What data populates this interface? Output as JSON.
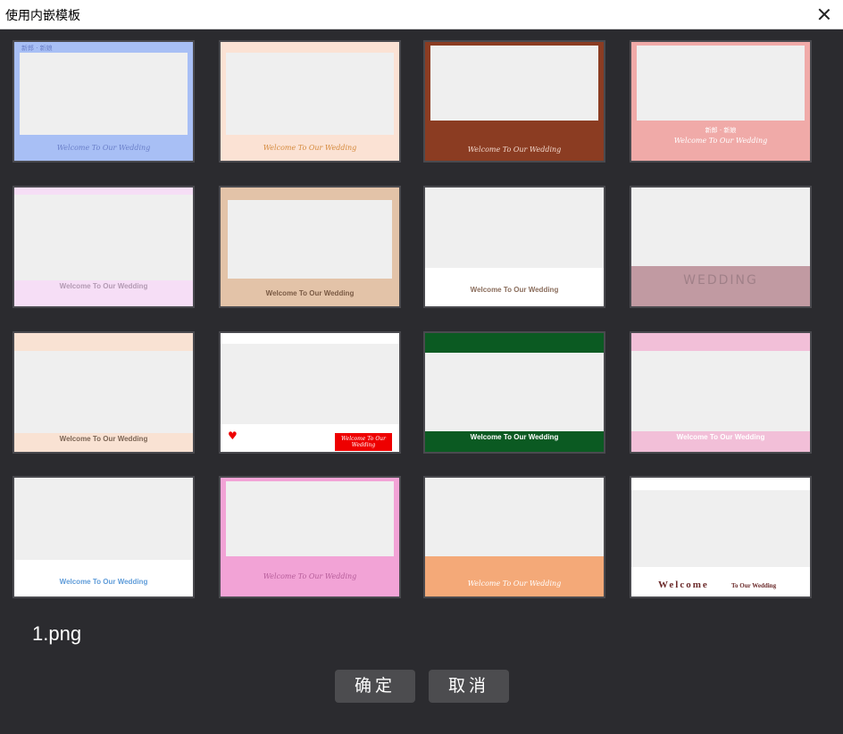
{
  "window": {
    "title": "使用内嵌模板"
  },
  "templates": [
    {
      "caption": "Welcome To Our Wedding",
      "header_text": "新郎 · 新娘",
      "bg": "#a8bff5",
      "cap_color": "#6a7fc9"
    },
    {
      "caption": "Welcome To Our Wedding",
      "bg": "#fbe2d4",
      "cap_color": "#d58a3d"
    },
    {
      "caption": "Welcome To Our Wedding",
      "bg": "#8b3c22",
      "cap_color": "#f2d8cc"
    },
    {
      "caption": "Welcome To Our Wedding",
      "header_text": "新郎 · 新娘",
      "bg": "#f0aaa8",
      "cap_color": "#ffffff"
    },
    {
      "caption": "Welcome To Our Wedding",
      "bg": "#f6def6",
      "cap_color": "#b39ab3"
    },
    {
      "caption": "Welcome To Our Wedding",
      "bg": "#e3c3a8",
      "cap_color": "#7a5a44"
    },
    {
      "caption": "Welcome To Our Wedding",
      "bg": "#ffffff",
      "cap_color": "#8a6d5c"
    },
    {
      "caption": "WEDDING",
      "bg": "#c19aa2",
      "cap_color": "#a08088"
    },
    {
      "caption": "Welcome To Our Wedding",
      "bg": "#f9e2d3",
      "cap_color": "#7c6555"
    },
    {
      "caption": "Welcome To Our Wedding",
      "bg": "#ffffff",
      "cap_color": "#ffffff"
    },
    {
      "caption": "Welcome To Our Wedding",
      "bg": "#0b5a22",
      "cap_color": "#ffffff"
    },
    {
      "caption": "Welcome To Our Wedding",
      "bg": "#f2bfd8",
      "cap_color": "#ffffff"
    },
    {
      "caption": "Welcome To Our Wedding",
      "bg": "#ffffff",
      "cap_color": "#5f9cd9"
    },
    {
      "caption": "Welcome To Our Wedding",
      "bg": "#f2a3d6",
      "cap_color": "#b65d9a"
    },
    {
      "caption": "Welcome To Our Wedding",
      "bg": "#f4a978",
      "cap_color": "#ffffff"
    },
    {
      "caption": "Welcome",
      "caption_suffix": "To Our Wedding",
      "bg": "#ffffff",
      "cap_color": "#6b2a2a"
    }
  ],
  "selected_file": "1.png",
  "buttons": {
    "confirm": "确定",
    "cancel": "取消"
  }
}
